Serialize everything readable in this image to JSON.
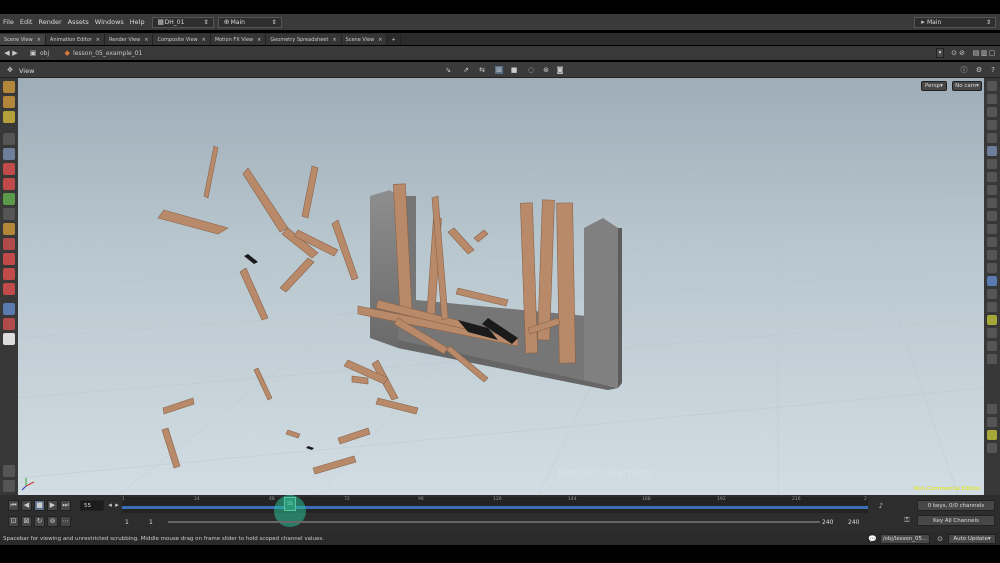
{
  "menubar": {
    "items": [
      "File",
      "Edit",
      "Render",
      "Assets",
      "Windows",
      "Help"
    ],
    "desktop": "DH_01",
    "session": "Main",
    "right_session": "Main"
  },
  "tabs": [
    "Scene View",
    "Animation Editor",
    "Render View",
    "Composite View",
    "Motion FX View",
    "Geometry Spreadsheet",
    "Scene View"
  ],
  "path": {
    "root": "obj",
    "node": "lesson_05_example_01"
  },
  "view": {
    "title": "View",
    "persp": "Persp",
    "cam": "No cam"
  },
  "viewport": {
    "license_note": "Non-Commercial Edition",
    "watermark": "Houdini Learning",
    "colors": {
      "sky_top": "#9eadb8",
      "floor": "#d1dde2",
      "wood": "#b88a6a",
      "wall": "#7c7c7c"
    }
  },
  "timeline": {
    "current_frame": "55",
    "ticks": [
      "1",
      "24",
      "48",
      "55",
      "72",
      "96",
      "120",
      "144",
      "168",
      "192",
      "216",
      "2"
    ],
    "range_start": "1",
    "range_start2": "1",
    "range_end": "240",
    "range_end2": "240",
    "keys_text": "0 keys, 0/0 channels",
    "key_all": "Key All Channels",
    "progress": 0.225
  },
  "status": {
    "message": "Spacebar for viewing and unrestricted scrubbing. Middle mouse drag on frame slider to hold scoped channel values.",
    "node_path": "/obj/lesson_05...",
    "update_mode": "Auto Update"
  }
}
